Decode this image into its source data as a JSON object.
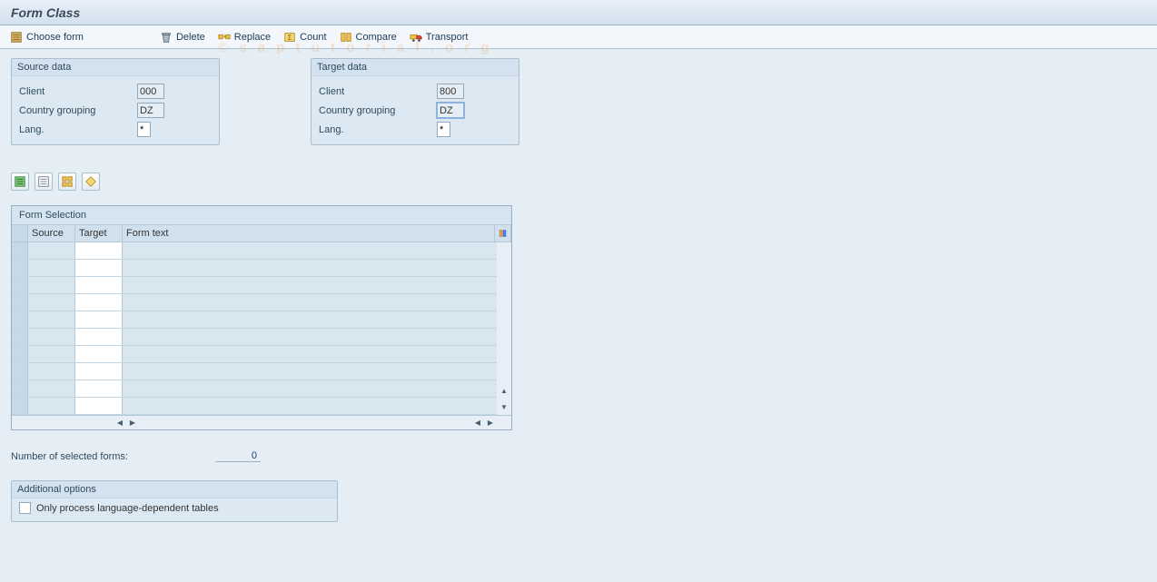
{
  "title": "Form Class",
  "toolbar": {
    "choose": "Choose form",
    "delete": "Delete",
    "replace": "Replace",
    "count": "Count",
    "compare": "Compare",
    "transport": "Transport"
  },
  "source_box": {
    "title": "Source data",
    "client_label": "Client",
    "client_value": "000",
    "country_label": "Country grouping",
    "country_value": "DZ",
    "lang_label": "Lang.",
    "lang_value": "*"
  },
  "target_box": {
    "title": "Target data",
    "client_label": "Client",
    "client_value": "800",
    "country_label": "Country grouping",
    "country_value": "DZ",
    "lang_label": "Lang.",
    "lang_value": "*"
  },
  "icon_buttons": {
    "a": "select-all-icon",
    "b": "deselect-all-icon",
    "c": "layout-icon",
    "d": "diamond-icon"
  },
  "table": {
    "title": "Form Selection",
    "col_source": "Source",
    "col_target": "Target",
    "col_text": "Form text"
  },
  "count": {
    "label": "Number of selected forms:",
    "value": "0"
  },
  "options": {
    "title": "Additional options",
    "only_lang": "Only process language-dependent tables"
  },
  "watermark": "©  s a p t u t o r i a l . o r g"
}
